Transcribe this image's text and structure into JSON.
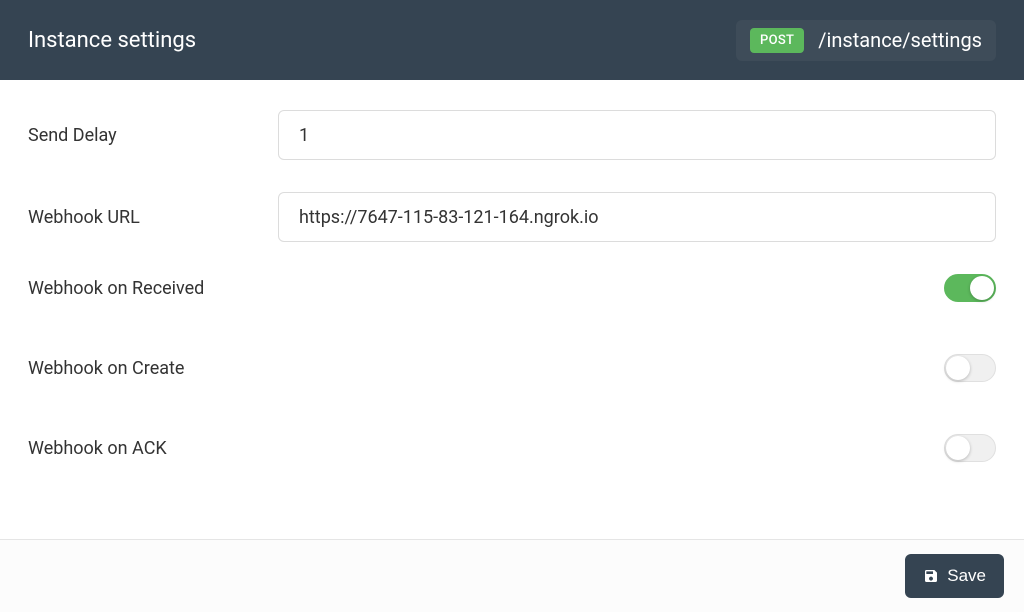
{
  "header": {
    "title": "Instance settings",
    "method": "POST",
    "path": "/instance/settings"
  },
  "fields": {
    "send_delay": {
      "label": "Send Delay",
      "value": "1"
    },
    "webhook_url": {
      "label": "Webhook URL",
      "value": "https://7647-115-83-121-164.ngrok.io"
    },
    "webhook_received": {
      "label": "Webhook on Received",
      "enabled": true
    },
    "webhook_create": {
      "label": "Webhook on Create",
      "enabled": false
    },
    "webhook_ack": {
      "label": "Webhook on ACK",
      "enabled": false
    }
  },
  "footer": {
    "save_label": "Save"
  }
}
